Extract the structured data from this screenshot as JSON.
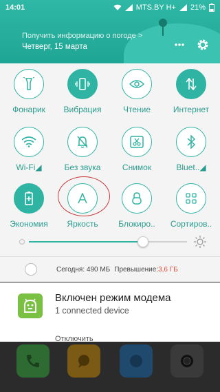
{
  "status_bar": {
    "time": "14:01",
    "carrier": "MTS.BY H+",
    "battery": "21%"
  },
  "weather": {
    "prompt": "Получить информацию о погоде >",
    "date": "Четверг, 15 марта"
  },
  "toggles": [
    {
      "label": "Фонарик",
      "icon": "flashlight-icon",
      "active": false
    },
    {
      "label": "Вибрация",
      "icon": "vibration-icon",
      "active": true
    },
    {
      "label": "Чтение",
      "icon": "eye-icon",
      "active": false
    },
    {
      "label": "Интернет",
      "icon": "data-arrows-icon",
      "active": true
    },
    {
      "label": "Wi-Fi◢",
      "icon": "wifi-icon",
      "active": false
    },
    {
      "label": "Без звука",
      "icon": "bell-off-icon",
      "active": false
    },
    {
      "label": "Снимок",
      "icon": "screenshot-icon",
      "active": false
    },
    {
      "label": "Bluet..◢",
      "icon": "bluetooth-icon",
      "active": false
    },
    {
      "label": "Экономия",
      "icon": "battery-saver-icon",
      "active": true
    },
    {
      "label": "Яркость",
      "icon": "auto-brightness-icon",
      "active": false
    },
    {
      "label": "Блокиро..",
      "icon": "lock-icon",
      "active": false
    },
    {
      "label": "Сортиров..",
      "icon": "grid-icon",
      "active": false
    }
  ],
  "brightness": {
    "level": 0.72
  },
  "usage": {
    "today": "Сегодня: 490 МБ",
    "exceed_prefix": "Превышение:",
    "exceed_value": "3,6 ГБ"
  },
  "notification": {
    "title": "Включен режим модема",
    "subtitle": "1 connected device",
    "action": "Отключить"
  },
  "colors": {
    "accent": "#2fb3a2",
    "warning": "#e04b3a"
  }
}
